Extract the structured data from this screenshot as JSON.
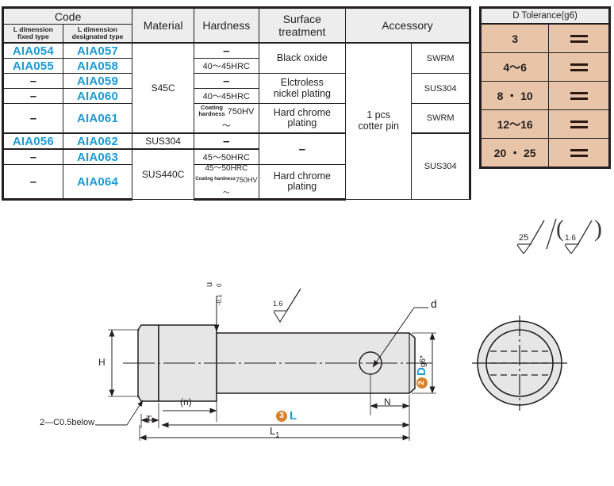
{
  "spec_table": {
    "headers": {
      "code": "Code",
      "code_sub_1": "L dimension",
      "code_sub_1b": "fixed type",
      "code_sub_2": "L dimension",
      "code_sub_2b": "designated type",
      "material": "Material",
      "hardness": "Hardness",
      "surface_treatment": "Surface treatment",
      "accessory": "Accessory"
    },
    "rows": [
      {
        "code_fixed": "AIA054",
        "code_designated": "AIA057",
        "hardness": "–"
      },
      {
        "code_fixed": "AIA055",
        "code_designated": "AIA058",
        "hardness": "40～45HRC"
      },
      {
        "code_fixed": "–",
        "code_designated": "AIA059",
        "hardness": "–"
      },
      {
        "code_fixed": "–",
        "code_designated": "AIA060",
        "hardness": "40～45HRC"
      },
      {
        "code_fixed": "–",
        "code_designated": "AIA061",
        "hardness_pre": "Coating",
        "hardness_pre2": "hardness",
        "hardness": "750HV～"
      },
      {
        "code_fixed": "AIA056",
        "code_designated": "AIA062",
        "hardness": "–"
      },
      {
        "code_fixed": "–",
        "code_designated": "AIA063",
        "hardness": "45～50HRC"
      },
      {
        "code_fixed": "–",
        "code_designated": "AIA064",
        "hardness": "45～50HRC",
        "hardness_sub_a": "Coating hardness",
        "hardness_sub_b": "750HV～"
      }
    ],
    "materials": [
      {
        "label": "S45C",
        "span": 5
      },
      {
        "label": "SUS304",
        "span": 1
      },
      {
        "label": "SUS440C",
        "span": 2
      }
    ],
    "surface_treatments": [
      {
        "label": "Black oxide",
        "span": 2
      },
      {
        "label": "Elctroless",
        "label2": "nickel plating",
        "span": 2
      },
      {
        "label": "Hard chrome plating",
        "span": 1
      },
      {
        "label": "–",
        "span": 2
      },
      {
        "label": "Hard chrome plating",
        "span": 1
      }
    ],
    "accessory": {
      "line1": "1 pcs",
      "line2": "cotter pin",
      "span": 8
    },
    "accessory_materials": [
      {
        "label": "SWRM",
        "span": 2
      },
      {
        "label": "SUS304",
        "span": 2
      },
      {
        "label": "SWRM",
        "span": 1
      },
      {
        "label": "SUS304",
        "span": 3
      }
    ]
  },
  "tolerance_table": {
    "header": "D Tolerance(g6)",
    "rows": [
      {
        "size": "3",
        "upper": "—",
        "lower": "—"
      },
      {
        "size": "4～6",
        "upper": "—",
        "lower": "—"
      },
      {
        "size": "8 ・ 10",
        "upper": "—",
        "lower": "—"
      },
      {
        "size": "12～16",
        "upper": "—",
        "lower": "—"
      },
      {
        "size": "20 ・ 25",
        "upper": "—",
        "lower": "—"
      }
    ]
  },
  "roughness": {
    "primary": "25",
    "secondary": "1.6",
    "paren_open": "(",
    "paren_close": ")",
    "slash": "/"
  },
  "drawing": {
    "label_H": "H",
    "label_u": "u",
    "label_u_tol_upper": "0",
    "label_u_tol_lower": "-0.1",
    "label_T": "T",
    "label_n": "(n)",
    "label_chamfer": "2—C0.5below",
    "label_L_badge": "3",
    "label_L": "L",
    "label_L1": "L",
    "label_L1_sub": "1",
    "label_N": "N",
    "label_d": "d",
    "label_D_badge": "2",
    "label_D": "D",
    "label_D_fit": "g6",
    "label_D_star": "*",
    "label_rough_shaft": "1.6"
  },
  "colors": {
    "code_blue": "#1b9ad6",
    "badge_orange": "#d9822b",
    "header_gray": "#ededed",
    "tolerance_tan": "#e8c4a8",
    "ink": "#231f20",
    "part_fill": "#e6e6e6"
  }
}
